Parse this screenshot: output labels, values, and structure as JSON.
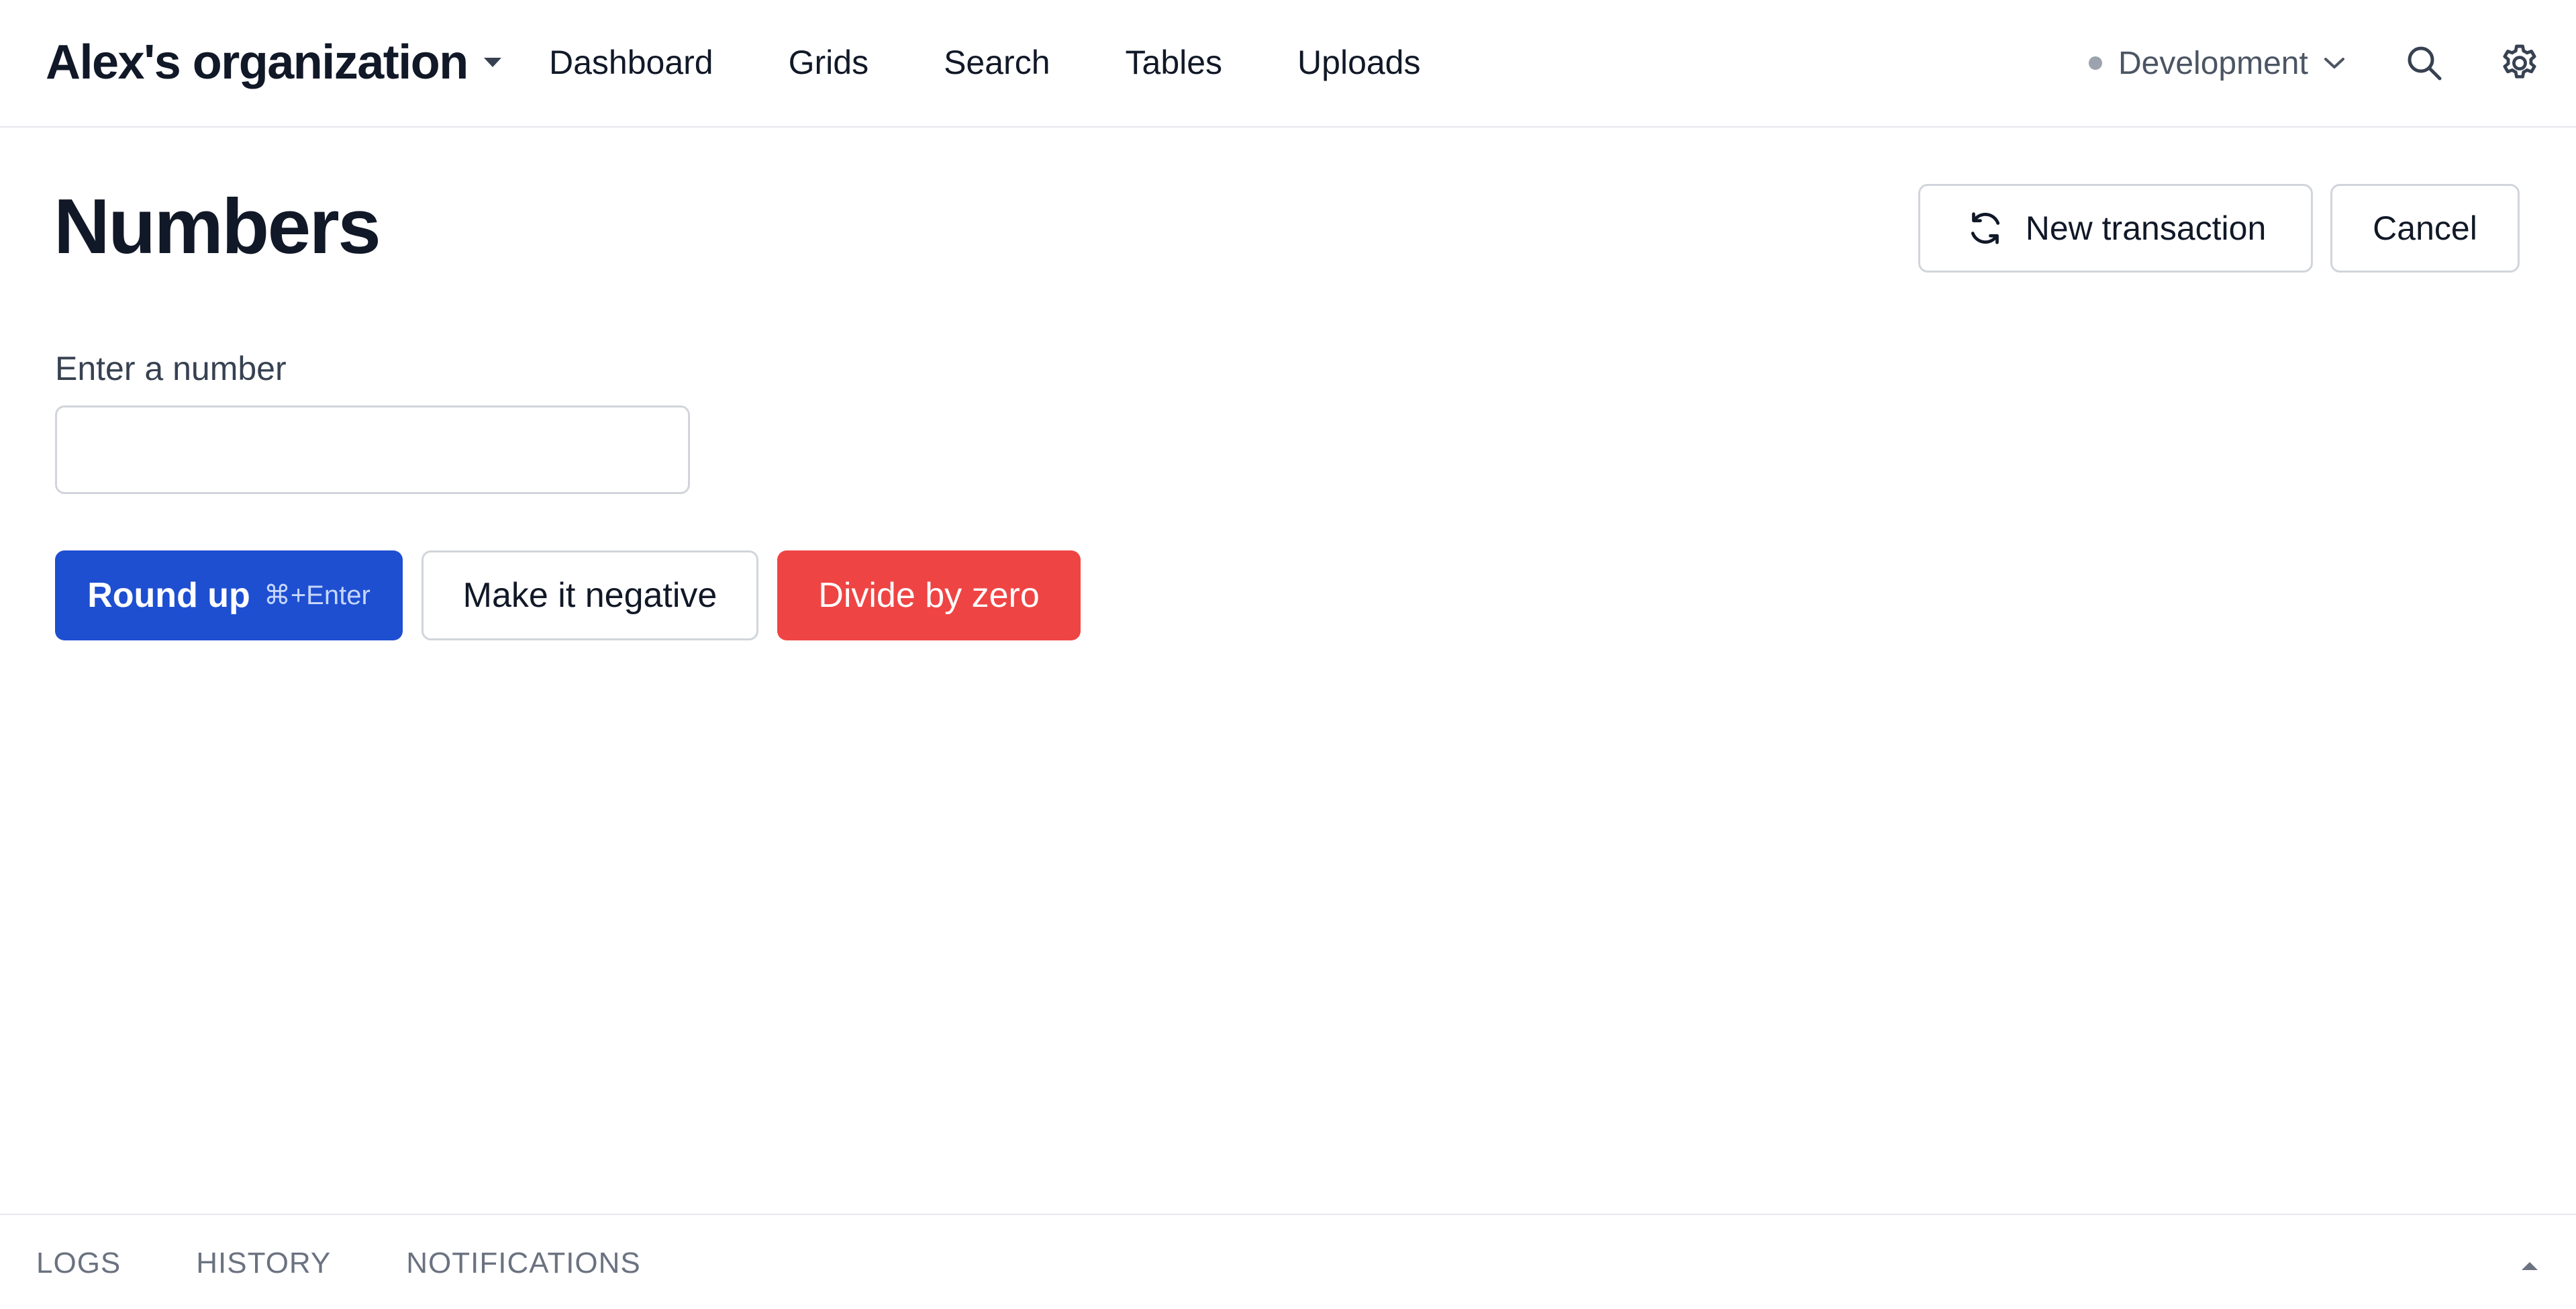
{
  "header": {
    "org_name": "Alex's organization",
    "nav": [
      {
        "label": "Dashboard"
      },
      {
        "label": "Grids"
      },
      {
        "label": "Search"
      },
      {
        "label": "Tables"
      },
      {
        "label": "Uploads"
      }
    ],
    "environment": "Development"
  },
  "main": {
    "title": "Numbers",
    "new_transaction_label": "New transaction",
    "cancel_label": "Cancel",
    "field_label": "Enter a number",
    "input_value": "",
    "input_placeholder": "",
    "round_up_label": "Round up",
    "round_up_shortcut": "⌘+Enter",
    "make_negative_label": "Make it negative",
    "divide_label": "Divide by zero"
  },
  "bottom_panel": {
    "tabs": [
      {
        "label": "LOGS"
      },
      {
        "label": "HISTORY"
      },
      {
        "label": "NOTIFICATIONS"
      }
    ]
  },
  "icons": {
    "org_caret": "caret-down-icon",
    "env_chevron": "chevron-down-icon",
    "search": "search-icon",
    "settings": "gear-icon",
    "refresh": "refresh-icon",
    "panel_toggle": "caret-up-icon"
  },
  "colors": {
    "primary": "#1e4fd1",
    "danger": "#ef4444",
    "border": "#d1d5db",
    "text": "#111827",
    "muted": "#6b7280"
  }
}
